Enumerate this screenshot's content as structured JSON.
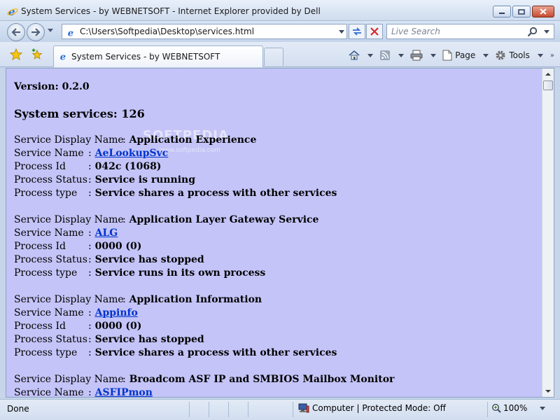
{
  "window": {
    "title": "System Services - by WEBNETSOFT - Internet Explorer provided by Dell"
  },
  "address_bar": {
    "url": "C:\\Users\\Softpedia\\Desktop\\services.html"
  },
  "search": {
    "placeholder": "Live Search"
  },
  "tab": {
    "label": "System Services - by WEBNETSOFT"
  },
  "toolbar": {
    "page_label": "Page",
    "tools_label": "Tools",
    "chevrons": "»"
  },
  "page": {
    "version": "Version: 0.2.0",
    "services_count": "System services: 126",
    "labels": {
      "display_name": "Service Display Name",
      "service_name": "Service Name",
      "process_id": "Process Id",
      "process_status": "Process Status",
      "process_type": "Process type"
    },
    "separator": ":",
    "services": [
      {
        "display_name": "Application Experience",
        "service_name": "AeLookupSvc",
        "process_id": "042c (1068)",
        "process_status": "Service is running",
        "process_type": "Service shares a process with other services"
      },
      {
        "display_name": "Application Layer Gateway Service",
        "service_name": "ALG",
        "process_id": "0000 (0)",
        "process_status": "Service has stopped",
        "process_type": "Service runs in its own process"
      },
      {
        "display_name": "Application Information",
        "service_name": "Appinfo",
        "process_id": "0000 (0)",
        "process_status": "Service has stopped",
        "process_type": "Service shares a process with other services"
      },
      {
        "display_name": "Broadcom ASF IP and SMBIOS Mailbox Monitor",
        "service_name": "ASFIPmon"
      }
    ]
  },
  "watermark": {
    "main": "SOFTPEDIA",
    "sub": "www.softpedia.com"
  },
  "status_bar": {
    "status": "Done",
    "zone": "Computer | Protected Mode: Off",
    "zoom": "100%"
  },
  "colors": {
    "page_background": "#c4c4f8",
    "link": "#0033cc"
  }
}
